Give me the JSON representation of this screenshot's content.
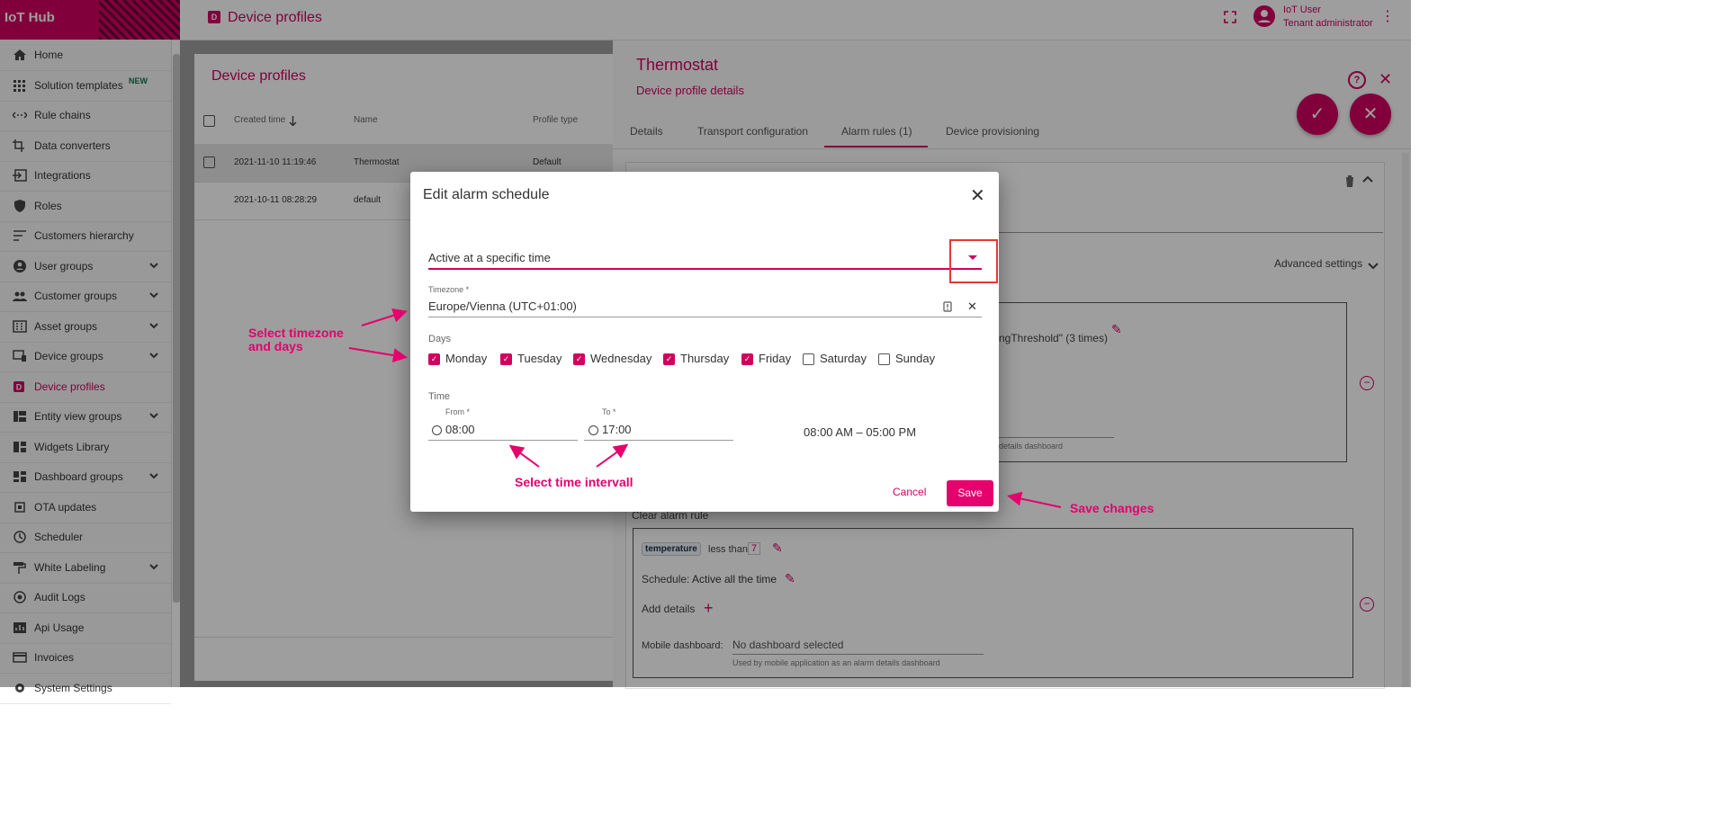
{
  "app": {
    "logo_text": "IoT Hub",
    "page_badge": "D",
    "page_title": "Device profiles"
  },
  "user": {
    "name": "IoT User",
    "role": "Tenant administrator"
  },
  "sidebar": {
    "items": [
      {
        "label": "Home",
        "icon": "home-icon"
      },
      {
        "label": "Solution templates",
        "icon": "grid-icon",
        "badge": "NEW"
      },
      {
        "label": "Rule chains",
        "icon": "rule-chain-icon"
      },
      {
        "label": "Data converters",
        "icon": "converter-icon"
      },
      {
        "label": "Integrations",
        "icon": "integration-icon"
      },
      {
        "label": "Roles",
        "icon": "shield-icon"
      },
      {
        "label": "Customers hierarchy",
        "icon": "hierarchy-icon"
      },
      {
        "label": "User groups",
        "icon": "user-icon"
      },
      {
        "label": "Customer groups",
        "icon": "people-icon"
      },
      {
        "label": "Asset groups",
        "icon": "building-icon"
      },
      {
        "label": "Device groups",
        "icon": "device-icon"
      },
      {
        "label": "Device profiles",
        "icon": "device-profile-icon"
      },
      {
        "label": "Entity view groups",
        "icon": "view-icon"
      },
      {
        "label": "Widgets Library",
        "icon": "widgets-icon"
      },
      {
        "label": "Dashboard groups",
        "icon": "dashboard-icon"
      },
      {
        "label": "OTA updates",
        "icon": "ota-icon"
      },
      {
        "label": "Scheduler",
        "icon": "clock-icon"
      },
      {
        "label": "White Labeling",
        "icon": "paint-roller-icon"
      },
      {
        "label": "Audit Logs",
        "icon": "audit-icon"
      },
      {
        "label": "Api Usage",
        "icon": "chart-icon"
      },
      {
        "label": "Invoices",
        "icon": "card-icon"
      },
      {
        "label": "System Settings",
        "icon": "settings-icon"
      }
    ]
  },
  "list": {
    "title": "Device profiles",
    "columns": {
      "created": "Created time",
      "name": "Name",
      "type": "Profile type"
    },
    "rows": [
      {
        "created": "2021-11-10 11:19:46",
        "name": "Thermostat",
        "type": "Default"
      },
      {
        "created": "2021-10-11 08:28:29",
        "name": "default",
        "type": ""
      }
    ]
  },
  "detail": {
    "title": "Thermostat",
    "subtitle": "Device profile details",
    "help": "?",
    "tabs": [
      "Details",
      "Transport configuration",
      "Alarm rules (1)",
      "Device provisioning"
    ],
    "advanced_settings": "Advanced settings",
    "create_condition_fragment": "ngThreshold\" (3 times)",
    "details_dashboard_fragment": "details dashboard",
    "clear_alarm_rule": "Clear alarm rule",
    "clear_condition": {
      "key": "temperature",
      "op": "less than",
      "value": "7"
    },
    "schedule_label": "Schedule:",
    "schedule_value": "Active all the time",
    "add_details": "Add details",
    "mobile_dashboard_label": "Mobile dashboard:",
    "mobile_dashboard_value": "No dashboard selected",
    "mobile_dashboard_hint": "Used by mobile application as an alarm details dashboard"
  },
  "dialog": {
    "title": "Edit alarm schedule",
    "schedule_type": "Active at a specific time",
    "timezone_label": "Timezone *",
    "timezone_value": "Europe/Vienna (UTC+01:00)",
    "days_label": "Days",
    "days": [
      {
        "label": "Monday",
        "checked": true
      },
      {
        "label": "Tuesday",
        "checked": true
      },
      {
        "label": "Wednesday",
        "checked": true
      },
      {
        "label": "Thursday",
        "checked": true
      },
      {
        "label": "Friday",
        "checked": true
      },
      {
        "label": "Saturday",
        "checked": false
      },
      {
        "label": "Sunday",
        "checked": false
      }
    ],
    "time_label": "Time",
    "from_label": "From *",
    "from_value": "08:00",
    "to_label": "To *",
    "to_value": "17:00",
    "range_text": "08:00 AM – 05:00 PM",
    "cancel": "Cancel",
    "save": "Save"
  },
  "annotations": {
    "timezone_days": "Select timezone and days",
    "time_interval": "Select time intervall",
    "save_changes": "Save changes"
  },
  "colors": {
    "accent": "#d1005f",
    "annotation": "#e5006d",
    "highlight_box": "#e53935"
  }
}
